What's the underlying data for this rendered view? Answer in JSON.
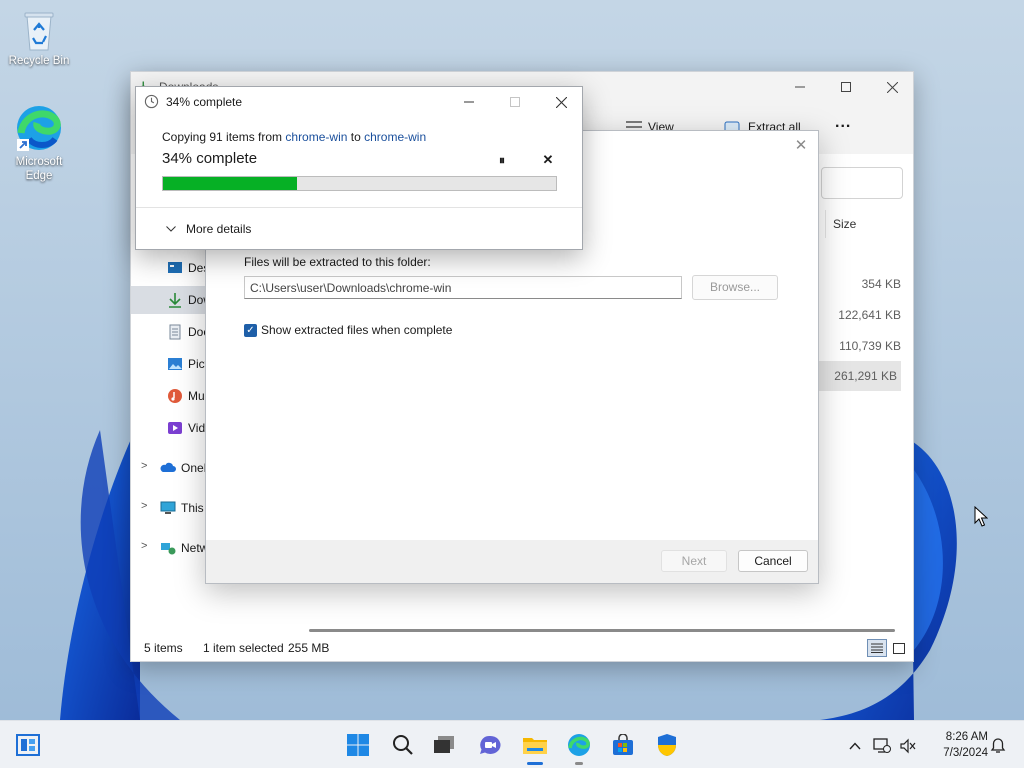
{
  "desktop": {
    "icons": [
      {
        "label": "Recycle Bin",
        "icon": "recycle-bin-icon"
      },
      {
        "label": "Microsoft Edge",
        "icon": "edge-icon"
      }
    ]
  },
  "explorer": {
    "title": "Downloads",
    "toolbar": {
      "view_label": "View",
      "extract_label": "Extract all",
      "more_label": "..."
    },
    "size_header": "Size",
    "nav": [
      {
        "label": "Desktop",
        "icon": "desktop-icon"
      },
      {
        "label": "Downloads",
        "icon": "download-icon",
        "selected": true
      },
      {
        "label": "Documents",
        "icon": "documents-icon"
      },
      {
        "label": "Pictures",
        "icon": "pictures-icon"
      },
      {
        "label": "Music",
        "icon": "music-icon"
      },
      {
        "label": "Videos",
        "icon": "videos-icon"
      },
      {
        "label": "OneDrive",
        "icon": "onedrive-icon"
      },
      {
        "label": "This PC",
        "icon": "pc-icon"
      },
      {
        "label": "Network",
        "icon": "network-icon"
      }
    ],
    "sizes": [
      "354 KB",
      "122,641 KB",
      "110,739 KB",
      "261,291 KB"
    ],
    "status": {
      "items": "5 items",
      "selected": "1 item selected",
      "size": "255 MB"
    }
  },
  "extract_dialog": {
    "folder_label": "Files will be extracted to this folder:",
    "path": "C:\\Users\\user\\Downloads\\chrome-win",
    "browse_label": "Browse...",
    "show_files_label": "Show extracted files when complete",
    "show_files_checked": true,
    "next_label": "Next",
    "cancel_label": "Cancel"
  },
  "copy_dialog": {
    "title": "34% complete",
    "copy_prefix": "Copying 91 items from",
    "source": "chrome-win",
    "to_word": "to",
    "destination": "chrome-win",
    "percent_text": "34% complete",
    "progress": 0.34,
    "more_details_label": "More details"
  },
  "taskbar": {
    "time": "8:26 AM",
    "date": "7/3/2024",
    "apps": [
      "start-icon",
      "search-icon",
      "task-view-icon",
      "chat-icon",
      "file-explorer-icon",
      "edge-icon",
      "store-icon",
      "security-icon"
    ]
  },
  "colors": {
    "progress_fill": "#06b025",
    "accent": "#1e5fa8",
    "link": "#1a4f9c"
  }
}
